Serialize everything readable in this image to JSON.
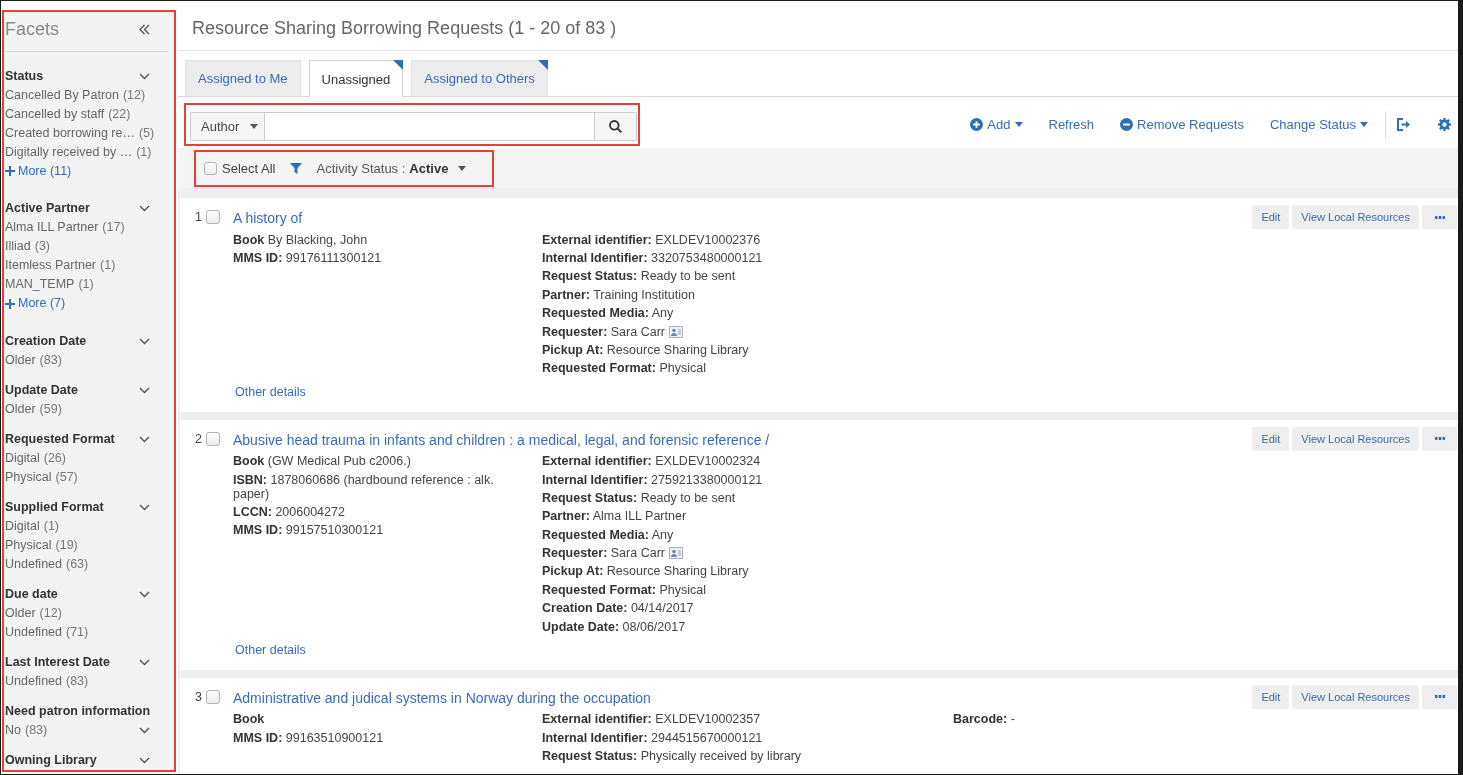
{
  "sidebar": {
    "title": "Facets",
    "highlighted": true,
    "groups": [
      {
        "title": "Status",
        "expanded": true,
        "items": [
          {
            "label": "Cancelled By Patron",
            "count": "(12)"
          },
          {
            "label": "Cancelled by staff",
            "count": "(22)"
          },
          {
            "label": "Created borrowing re…",
            "count": "(5)"
          },
          {
            "label": "Digitally received by …",
            "count": "(1)"
          }
        ],
        "more": "More (11)"
      },
      {
        "title": "Active Partner",
        "expanded": true,
        "items": [
          {
            "label": "Alma ILL Partner",
            "count": "(17)"
          },
          {
            "label": "Illiad",
            "count": "(3)"
          },
          {
            "label": "Itemless Partner",
            "count": "(1)"
          },
          {
            "label": "MAN_TEMP",
            "count": "(1)"
          }
        ],
        "more": "More (7)"
      },
      {
        "title": "Creation Date",
        "expanded": true,
        "items": [
          {
            "label": "Older",
            "count": "(83)"
          }
        ]
      },
      {
        "title": "Update Date",
        "expanded": true,
        "items": [
          {
            "label": "Older",
            "count": "(59)"
          }
        ]
      },
      {
        "title": "Requested Format",
        "expanded": true,
        "items": [
          {
            "label": "Digital",
            "count": "(26)"
          },
          {
            "label": "Physical",
            "count": "(57)"
          }
        ]
      },
      {
        "title": "Supplied Format",
        "expanded": true,
        "items": [
          {
            "label": "Digital",
            "count": "(1)"
          },
          {
            "label": "Physical",
            "count": "(19)"
          },
          {
            "label": "Undefined",
            "count": "(63)"
          }
        ]
      },
      {
        "title": "Due date",
        "expanded": true,
        "items": [
          {
            "label": "Older",
            "count": "(12)"
          },
          {
            "label": "Undefined",
            "count": "(71)"
          }
        ]
      },
      {
        "title": "Last Interest Date",
        "expanded": true,
        "items": [
          {
            "label": "Undefined",
            "count": "(83)"
          }
        ]
      },
      {
        "title": "Need patron information",
        "expanded": true,
        "items": [
          {
            "label": "No",
            "count": "(83)"
          }
        ]
      },
      {
        "title": "Owning Library",
        "expanded": true
      }
    ]
  },
  "page_title": "Resource Sharing Borrowing Requests (1 - 20 of 83 )",
  "tabs": [
    {
      "label": "Assigned to Me",
      "selected": false,
      "flagged": false
    },
    {
      "label": "Unassigned",
      "selected": true,
      "flagged": true
    },
    {
      "label": "Assigned to Others",
      "selected": false,
      "flagged": true
    }
  ],
  "search": {
    "highlighted": true,
    "field_selector": "Author"
  },
  "toolbar": [
    {
      "label": "Add",
      "kind": "add"
    },
    {
      "label": "Refresh",
      "kind": "plain"
    },
    {
      "label": "Remove Requests",
      "kind": "remove"
    },
    {
      "label": "Change Status",
      "kind": "menu"
    }
  ],
  "filter_bar": {
    "highlighted": true,
    "select_all": {
      "label": "Select All",
      "checked": false
    },
    "activity_status": {
      "label": "Activity Status :",
      "value": "Active"
    }
  },
  "requests": [
    {
      "number": "1",
      "checked": false,
      "title": "A history of",
      "format": "Book",
      "details": "By Blacking, John",
      "left_fields": [
        {
          "label": "MMS ID:",
          "value": "99176111300121"
        }
      ],
      "fields": [
        {
          "kind": "text",
          "label": "External identifier:",
          "value": "EXLDEV10002376"
        },
        {
          "kind": "text",
          "label": "Internal Identifier:",
          "value": "3320753480000121"
        },
        {
          "kind": "text",
          "label": "Request Status:",
          "value": "Ready to be sent"
        },
        {
          "kind": "text",
          "label": "Partner:",
          "value": "Training Institution"
        },
        {
          "kind": "text",
          "label": "Requested Media:",
          "value": "Any"
        },
        {
          "kind": "person",
          "label": "Requester:",
          "value": "Sara Carr"
        },
        {
          "kind": "text",
          "label": "Pickup At:",
          "value": "Resource Sharing Library"
        },
        {
          "kind": "text",
          "label": "Requested Format:",
          "value": "Physical"
        }
      ],
      "link": "Other details",
      "actions": [
        "Edit",
        "View Local Resources"
      ]
    },
    {
      "number": "2",
      "checked": false,
      "title": "Abusive head trauma in infants and children : a medical, legal, and forensic reference /",
      "format": "Book",
      "details": "(GW Medical Pub c2006.)",
      "left_fields": [
        {
          "label": "ISBN:",
          "value": "1878060686 (hardbound reference : alk. paper)"
        },
        {
          "label": "LCCN:",
          "value": "2006004272"
        },
        {
          "label": "MMS ID:",
          "value": "99157510300121"
        }
      ],
      "fields": [
        {
          "kind": "text",
          "label": "External identifier:",
          "value": "EXLDEV10002324"
        },
        {
          "kind": "text",
          "label": "Internal Identifier:",
          "value": "2759213380000121"
        },
        {
          "kind": "text",
          "label": "Request Status:",
          "value": "Ready to be sent"
        },
        {
          "kind": "text",
          "label": "Partner:",
          "value": "Alma ILL Partner"
        },
        {
          "kind": "text",
          "label": "Requested Media:",
          "value": "Any"
        },
        {
          "kind": "person",
          "label": "Requester:",
          "value": "Sara Carr"
        },
        {
          "kind": "text",
          "label": "Pickup At:",
          "value": "Resource Sharing Library"
        },
        {
          "kind": "text",
          "label": "Requested Format:",
          "value": "Physical"
        },
        {
          "kind": "text",
          "label": "Creation Date:",
          "value": "04/14/2017"
        },
        {
          "kind": "text",
          "label": "Update Date:",
          "value": "08/06/2017"
        }
      ],
      "link": "Other details",
      "actions": [
        "Edit",
        "View Local Resources"
      ]
    },
    {
      "number": "3",
      "checked": false,
      "title": "Administrative and judical systems in Norway during the occupation",
      "format": "Book",
      "left_fields": [
        {
          "label": "MMS ID:",
          "value": "99163510900121"
        }
      ],
      "fields": [
        {
          "kind": "text",
          "label": "External identifier:",
          "value": "EXLDEV10002357"
        },
        {
          "kind": "text",
          "label": "Internal Identifier:",
          "value": "2944515670000121"
        },
        {
          "kind": "text",
          "label": "Request Status:",
          "value": "Physically received by library"
        }
      ],
      "side_fields": [
        {
          "label": "Barcode:",
          "value": "-"
        }
      ],
      "actions": [
        "Edit",
        "View Local Resources"
      ]
    }
  ]
}
